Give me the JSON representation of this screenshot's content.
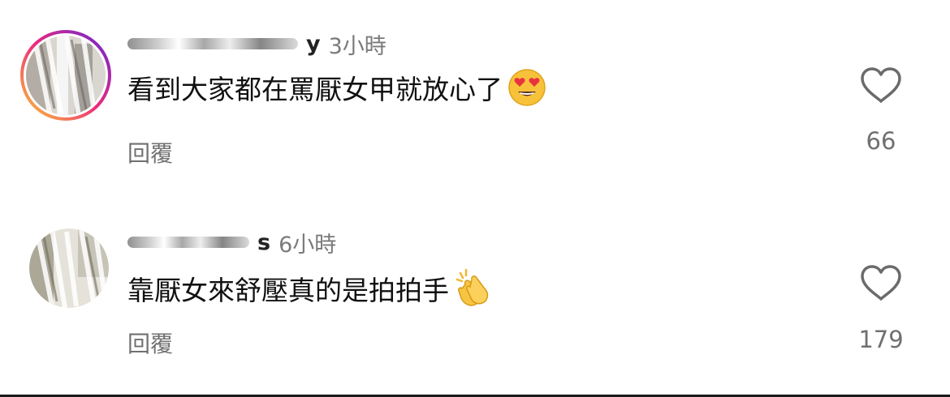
{
  "comments": [
    {
      "username_visible_suffix": "y",
      "timestamp": "3小時",
      "text": "看到大家都在罵厭女甲就放心了",
      "emoji": "heart-eyes-emoji",
      "reply_label": "回覆",
      "like_count": "66",
      "avatar_ring": "instagram-gradient-story-ring"
    },
    {
      "username_visible_suffix": "s",
      "timestamp": "6小時",
      "text": "靠厭女來舒壓真的是拍拍手",
      "emoji": "clapping-hands-emoji",
      "reply_label": "回覆",
      "like_count": "179",
      "avatar_ring": "none"
    }
  ],
  "icons": {
    "like": "heart-outline-icon"
  },
  "colors": {
    "text_primary": "#111111",
    "text_secondary": "#707070",
    "background": "#ffffff",
    "ring_gradient": [
      "#f9ce34",
      "#ee2a7b",
      "#6228d7"
    ]
  }
}
